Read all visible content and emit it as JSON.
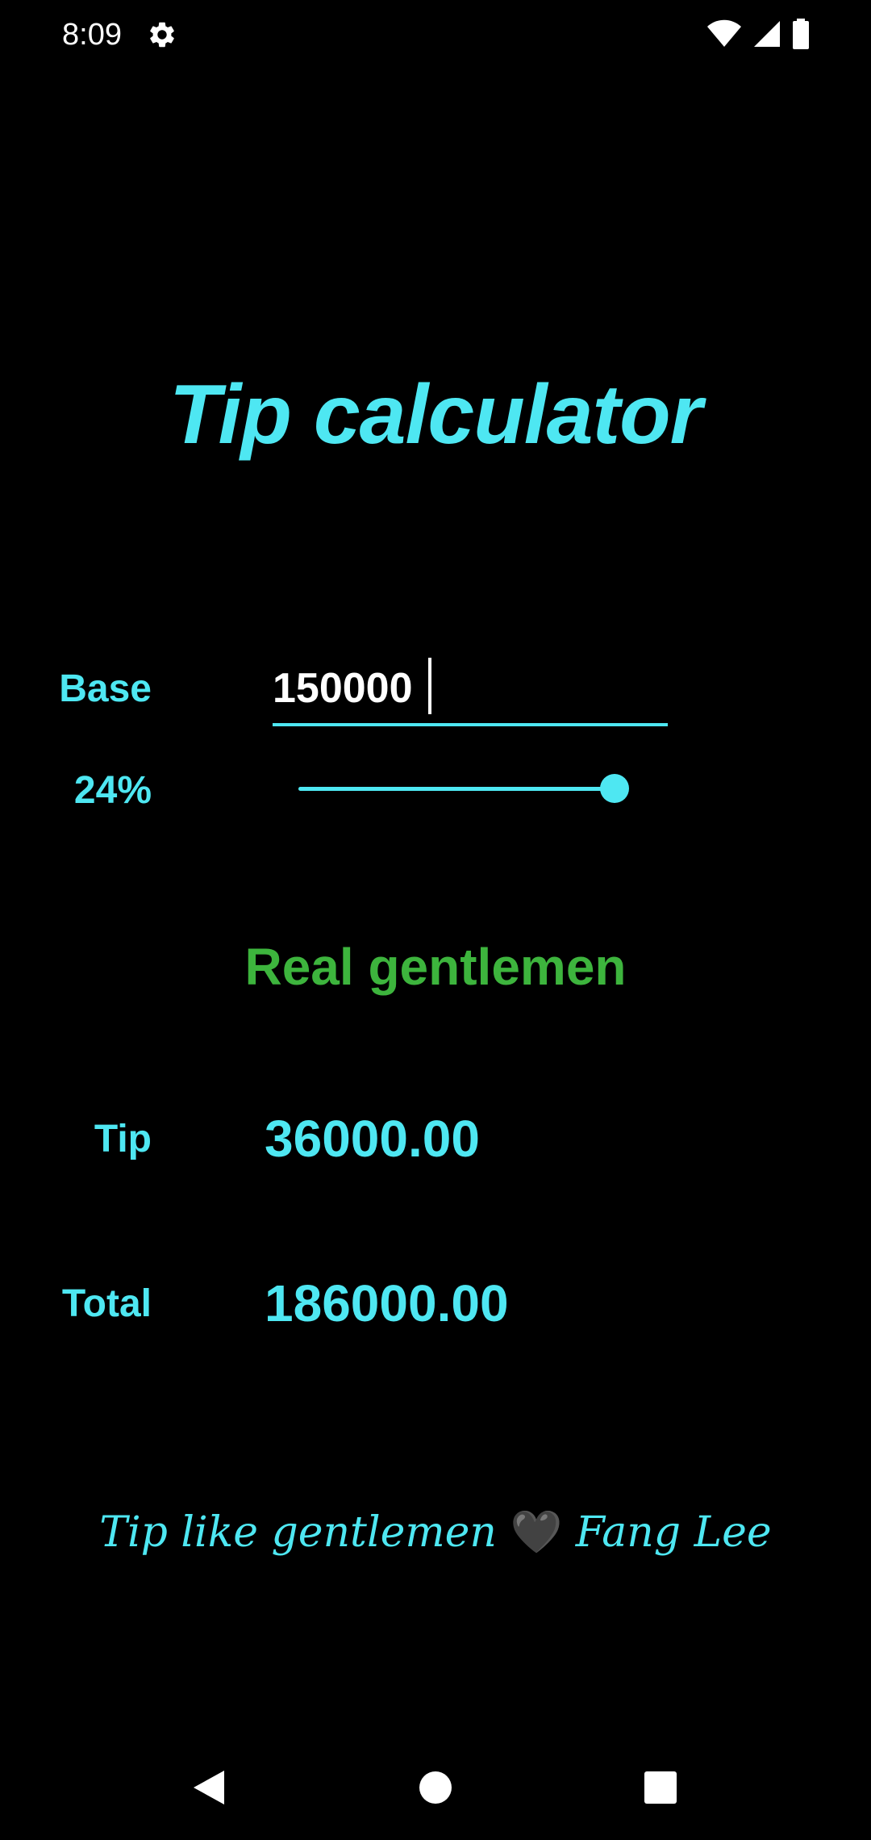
{
  "status_bar": {
    "time": "8:09",
    "icons": [
      "settings-gear-icon",
      "wifi-icon",
      "cell-signal-icon",
      "battery-icon"
    ]
  },
  "app": {
    "title": "Tip calculator",
    "base_label": "Base",
    "base_value": "150000",
    "percent_label": "24%",
    "slider_fraction": 0.24,
    "rating": "Real gentlemen",
    "tip_label": "Tip",
    "tip_value": "36000.00",
    "total_label": "Total",
    "total_value": "186000.00",
    "footer_text_before": "Tip like gentlemen",
    "footer_heart": "🖤",
    "footer_text_after": "Fang Lee"
  },
  "colors": {
    "accent": "#4ee7f2",
    "rating": "#3db43d",
    "background": "#000000"
  },
  "nav_bar": {
    "icons": [
      "back-icon",
      "home-icon",
      "recents-icon"
    ]
  }
}
